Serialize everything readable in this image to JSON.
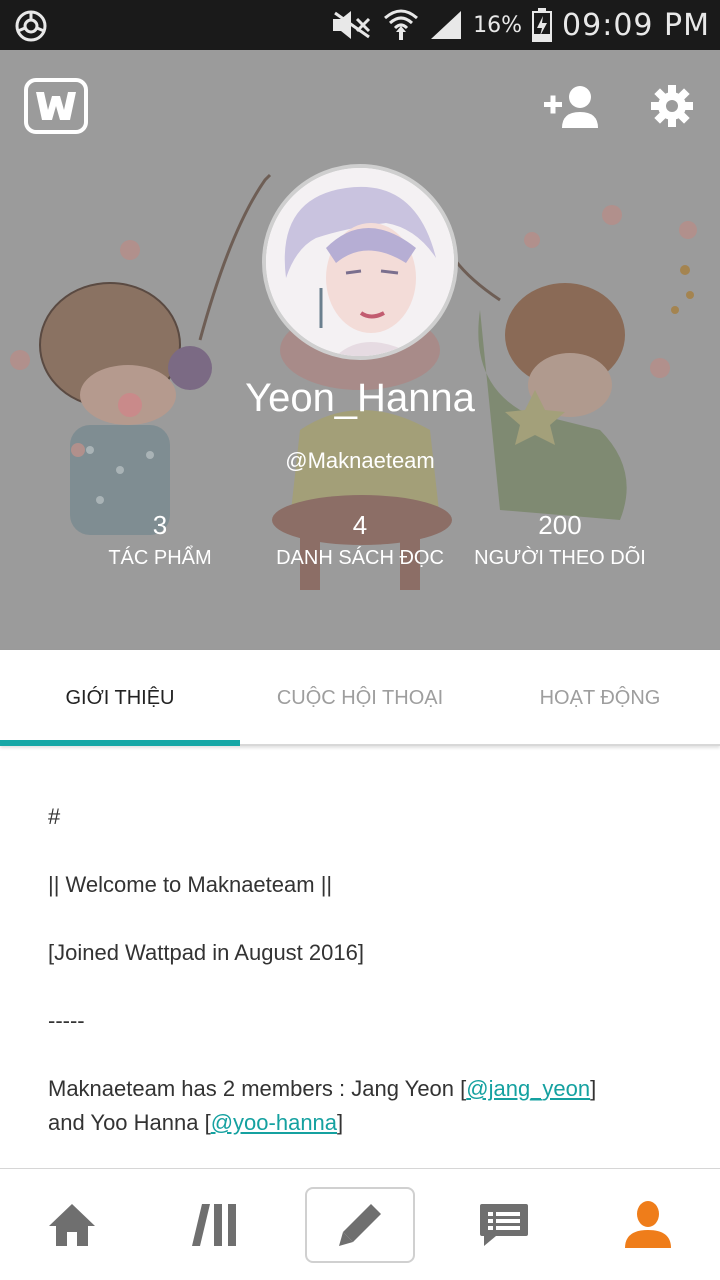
{
  "status_bar": {
    "battery_percent": "16%",
    "time": "09:09 PM"
  },
  "profile": {
    "display_name": "Yeon_Hanna",
    "handle": "@Maknaeteam",
    "stats": [
      {
        "value": "3",
        "label": "TÁC PHẨM"
      },
      {
        "value": "4",
        "label": "DANH SÁCH ĐỌC"
      },
      {
        "value": "200",
        "label": "NGƯỜI THEO DÕI"
      }
    ]
  },
  "tabs": [
    {
      "label": "GIỚI THIỆU",
      "active": true
    },
    {
      "label": "CUỘC HỘI THOẠI",
      "active": false
    },
    {
      "label": "HOẠT ĐỘNG",
      "active": false
    }
  ],
  "about": {
    "line1": "#",
    "line2": "|| Welcome to Maknaeteam ||",
    "line3": "[Joined Wattpad in August 2016]",
    "line4": "-----",
    "members_prefix": "Maknaeteam has 2 members : Jang Yeon [",
    "member1_link": "@jang_yeon",
    "members_mid": "]",
    "members_line2_prefix": "and Yoo Hanna [",
    "member2_link": "@yoo-hanna",
    "members_suffix": "]"
  },
  "colors": {
    "accent": "#16a7a6",
    "profile_icon": "#ef7d1a",
    "nav_icon": "#6f6f6f",
    "header_bg": "#9a9a9a"
  },
  "icons": {
    "logo": "wattpad-logo-icon",
    "add_user": "add-user-icon",
    "settings": "gear-icon",
    "nav": [
      "home-icon",
      "library-icon",
      "pencil-icon",
      "messages-icon",
      "profile-icon"
    ]
  }
}
